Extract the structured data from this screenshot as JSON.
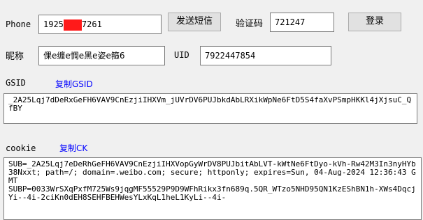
{
  "row1": {
    "phone_label": "Phone",
    "phone_prefix": "1925",
    "phone_suffix": "7261",
    "send_sms_label": "发送短信",
    "code_label": "验证码",
    "code_value": "721247",
    "login_label": "登录"
  },
  "row2": {
    "nickname_label": "昵称",
    "nickname_value": "倮e缠e惆e黑e姿e箍6",
    "uid_label": "UID",
    "uid_value": "7922447854"
  },
  "gsid": {
    "label": "GSID",
    "copy_label": "复制GSID",
    "value": "_2A25Lqj7dDeRxGeFH6VAV9CnEzjiIHXVm_jUVrDV6PUJbkdAbLRXikWpNe6FtD5S4faXvPSmpHKKl4jXjsuC_QfBY"
  },
  "cookie": {
    "label": "cookie",
    "copy_label": "复制CK",
    "value": "SUB=_2A25Lqj7eDeRhGeFH6VAV9CnEzjiIHXVopGyWrDV8PUJbitAbLVT-kWtNe6FtDyo-kVh-Rw42M3In3nyHYb38Nxxt; path=/; domain=.weibo.com; secure; httponly; expires=Sun, 04-Aug-2024 12:36:43 GMT\nSUBP=0033WrSXqPxfM725Ws9jqgMF55529P9D9WFhRikx3fn689q.5QR_WTzo5NHD95QN1KzEShBN1h-XWs4DqcjYi--4i-2ciKn0dEH8SEHFBEHWesYLxKqL1heL1KyLi--4i-"
  }
}
